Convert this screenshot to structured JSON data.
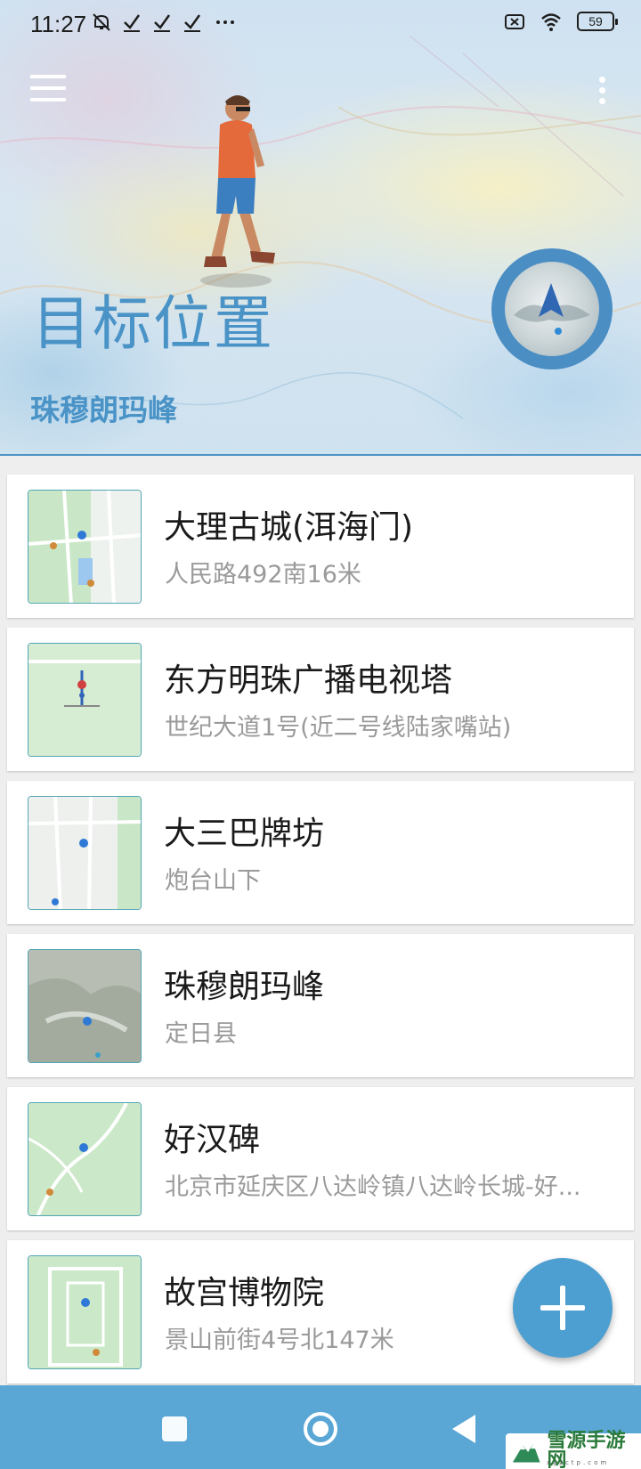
{
  "status_bar": {
    "time": "11:27",
    "battery": "59",
    "icons": [
      "mute-icon",
      "check-icon",
      "check-icon",
      "check-icon",
      "more-dots-icon",
      "sim-icon",
      "wifi-icon",
      "battery-icon"
    ]
  },
  "header": {
    "title": "目标位置",
    "subtitle": "珠穆朗玛峰",
    "accent_color": "#4a93c7"
  },
  "places": [
    {
      "name": "大理古城(洱海门)",
      "address": "人民路492南16米",
      "thumb": "green-map"
    },
    {
      "name": "东方明珠广播电视塔",
      "address": "世纪大道1号(近二号线陆家嘴站)",
      "thumb": "green-map"
    },
    {
      "name": "大三巴牌坊",
      "address": "炮台山下",
      "thumb": "gray-map"
    },
    {
      "name": "珠穆朗玛峰",
      "address": "定日县",
      "thumb": "satellite"
    },
    {
      "name": "好汉碑",
      "address": "北京市延庆区八达岭镇八达岭长城-好...",
      "thumb": "green-map"
    },
    {
      "name": "故宫博物院",
      "address": "景山前街4号北147米",
      "thumb": "green-map"
    }
  ],
  "watermark": {
    "text": "雪源手游网",
    "sub": "xyzctp.com"
  },
  "colors": {
    "nav_bar": "#5aa7d6",
    "fab": "#4e9fd1"
  }
}
